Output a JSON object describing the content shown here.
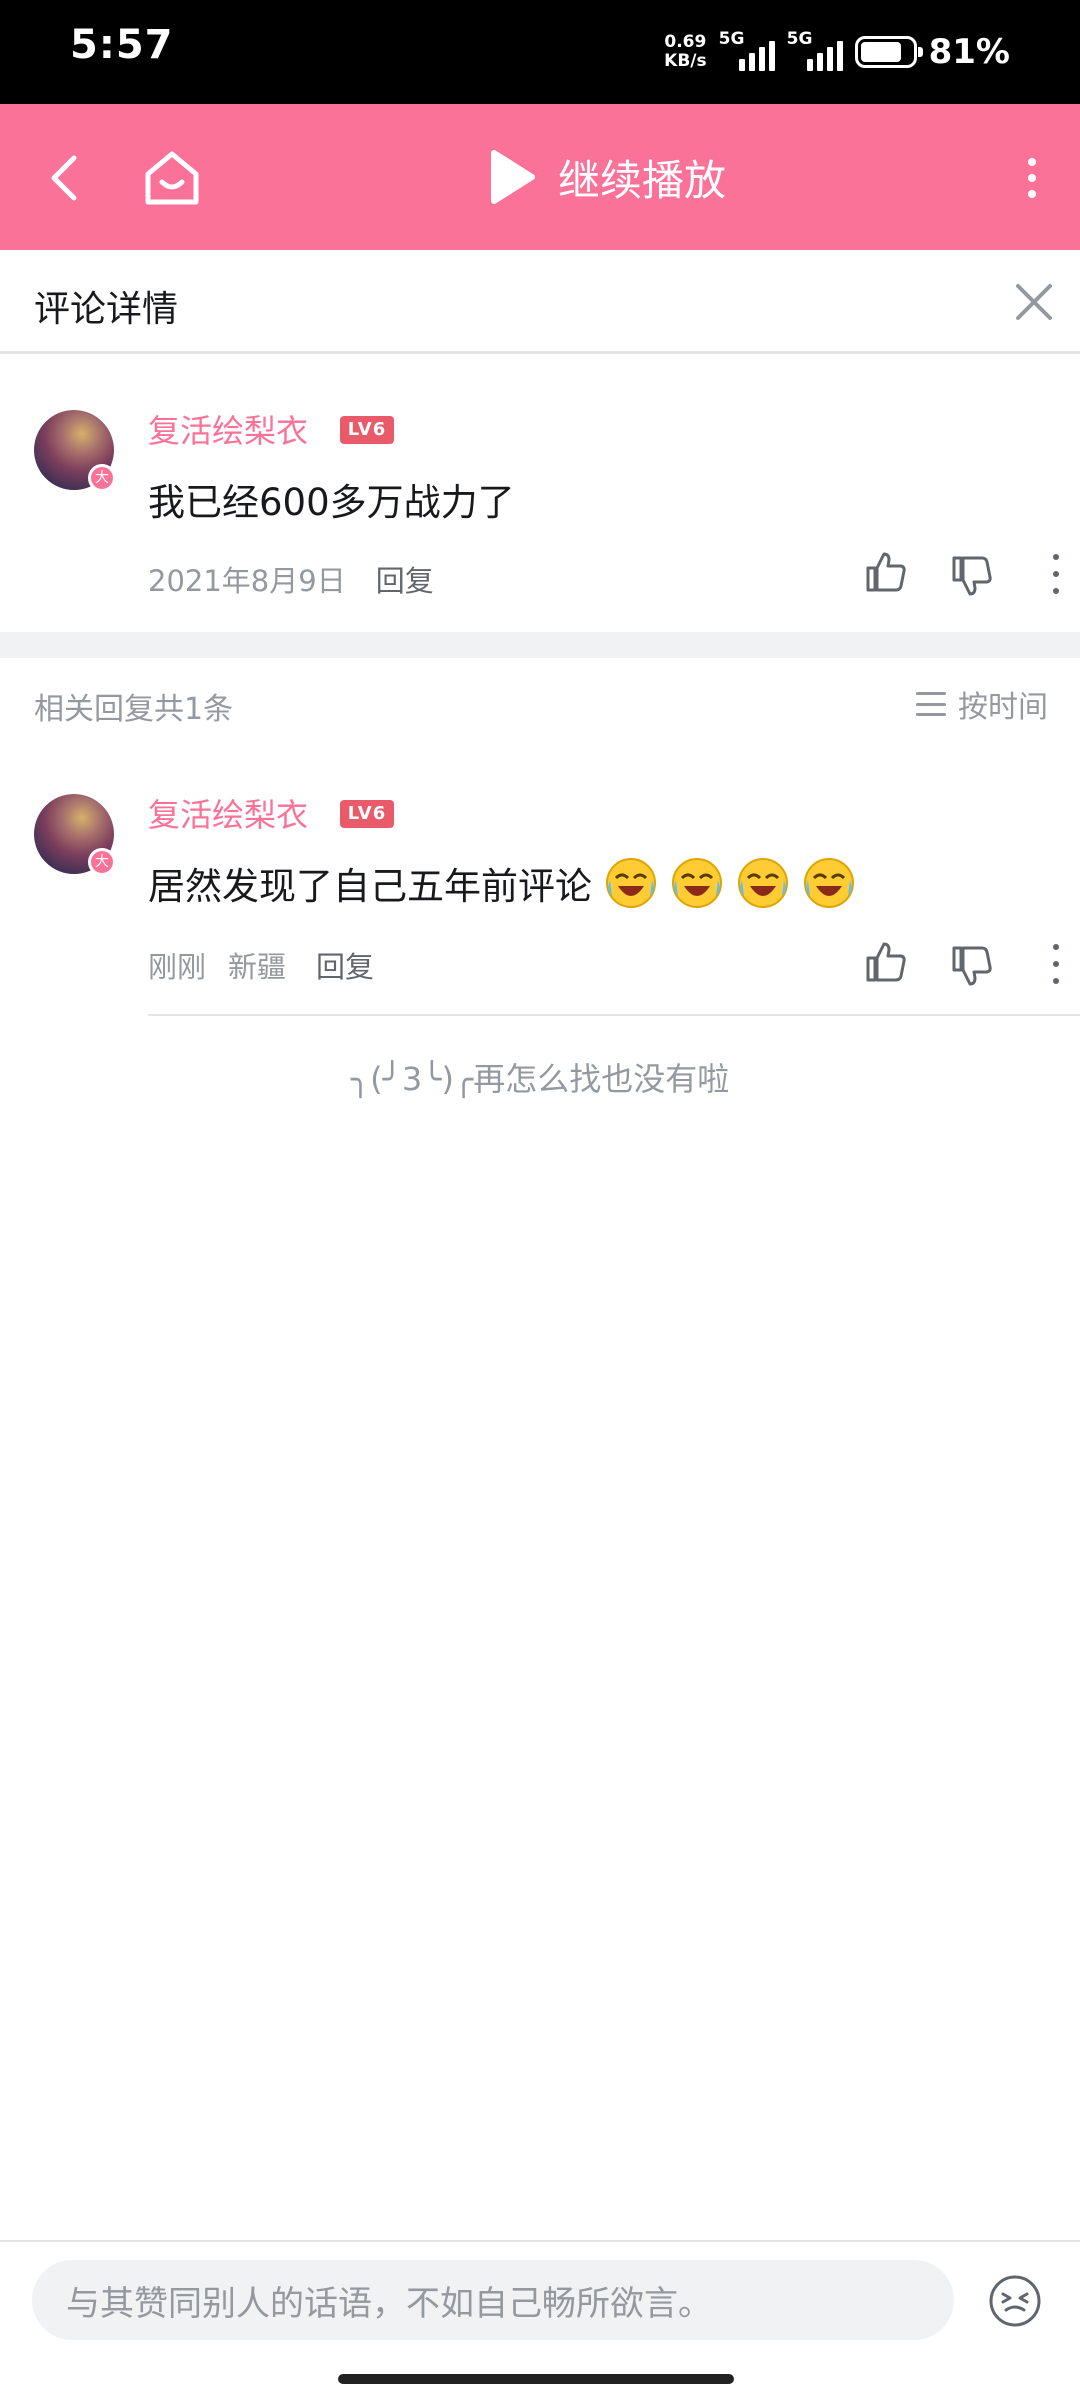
{
  "status_bar": {
    "time": "5:57",
    "speed_value": "0.69",
    "speed_unit": "KB/s",
    "network1": "5G",
    "network2": "5G",
    "battery_pct": "81%"
  },
  "topbar": {
    "resume_label": "继续播放",
    "color": "#fb7299"
  },
  "detail": {
    "title": "评论详情"
  },
  "root_comment": {
    "username": "复活绘梨衣",
    "level": "LV6",
    "avatar_badge": "大",
    "text": "我已经600多万战力了",
    "date": "2021年8月9日",
    "reply_label": "回复"
  },
  "replies": {
    "count_label": "相关回复共1条",
    "sort_label": "按时间"
  },
  "reply_comment": {
    "username": "复活绘梨衣",
    "level": "LV6",
    "avatar_badge": "大",
    "text": "居然发现了自己五年前评论",
    "emojis": [
      "laugh-cry-emoji",
      "laugh-cry-emoji",
      "laugh-cry-emoji",
      "laugh-cry-emoji"
    ],
    "time": "刚刚",
    "location": "新疆",
    "reply_label": "回复"
  },
  "end_note": "╮(╯3╰)╭再怎么找也没有啦",
  "input": {
    "placeholder": "与其赞同别人的话语，不如自己畅所欲言。"
  }
}
